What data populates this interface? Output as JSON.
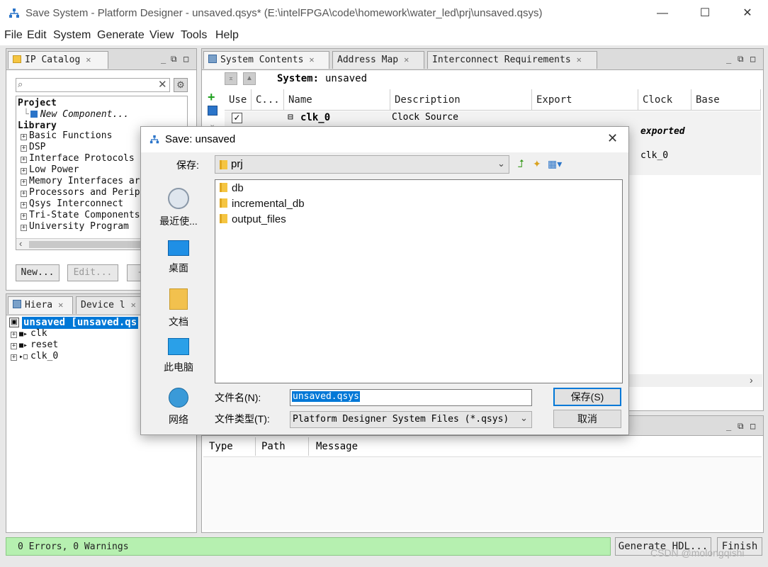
{
  "window": {
    "title": "Save System - Platform Designer - unsaved.qsys* (E:\\intelFPGA\\code\\homework\\water_led\\prj\\unsaved.qsys)",
    "controls": {
      "minimize": "—",
      "maximize": "☐",
      "close": "✕"
    }
  },
  "menu": [
    "File",
    "Edit",
    "System",
    "Generate",
    "View",
    "Tools",
    "Help"
  ],
  "ip_catalog": {
    "tab_label": "IP Catalog",
    "search_placeholder": "",
    "project_header": "Project",
    "new_component": "New Component...",
    "library_header": "Library",
    "library_items": [
      "Basic Functions",
      "DSP",
      "Interface Protocols",
      "Low Power",
      "Memory Interfaces ar",
      "Processors and Perip",
      "Qsys Interconnect",
      "Tri-State Components",
      "University Program"
    ],
    "new_button": "New...",
    "edit_button": "Edit...",
    "add_button": "+"
  },
  "hierarchy": {
    "tab_label": "Hiera",
    "device_tab_label": "Device l",
    "root": "unsaved [unsaved.qs",
    "items": [
      "clk",
      "reset",
      "clk_0"
    ]
  },
  "system_contents": {
    "tabs": [
      "System Contents",
      "Address Map",
      "Interconnect Requirements"
    ],
    "system_label": "System:",
    "system_name": "unsaved",
    "columns": [
      "Use",
      "C...",
      "Name",
      "Description",
      "Export",
      "Clock",
      "Base"
    ],
    "row": {
      "name": "clk_0",
      "description": "Clock Source",
      "export": "exported",
      "clock": "clk_0"
    }
  },
  "messages": {
    "columns": [
      "Type",
      "Path",
      "Message"
    ]
  },
  "status": {
    "text": "0 Errors, 0 Warnings",
    "generate_button": "Generate HDL...",
    "finish_button": "Finish"
  },
  "dialog": {
    "title": "Save: unsaved",
    "save_in_label": "保存:",
    "save_in_value": "prj",
    "places": [
      "最近使...",
      "桌面",
      "文档",
      "此电脑",
      "网络"
    ],
    "files": [
      "db",
      "incremental_db",
      "output_files"
    ],
    "filename_label": "文件名(N):",
    "filename_value": "unsaved.qsys",
    "filetype_label": "文件类型(T):",
    "filetype_value": "Platform Designer System Files (*.qsys)",
    "save_button": "保存(S)",
    "cancel_button": "取消"
  },
  "watermark": "CSDN @molongqishi",
  "colors": {
    "selection": "#0078d7",
    "status_ok": "#b6f0b0",
    "default_button_border": "#0078d7"
  }
}
